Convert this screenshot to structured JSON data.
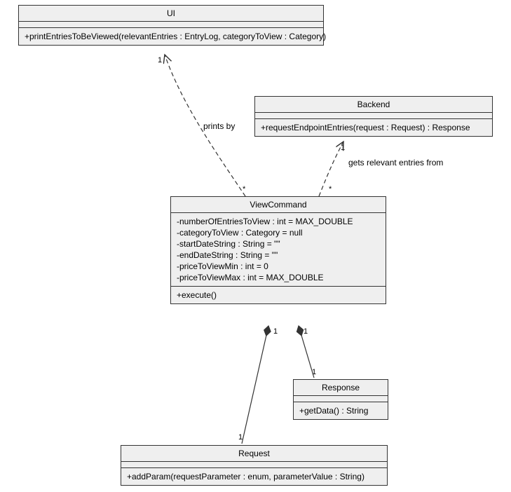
{
  "classes": {
    "ui": {
      "name": "UI",
      "methods": [
        "+printEntriesToBeViewed(relevantEntries : EntryLog, categoryToView : Category)"
      ]
    },
    "backend": {
      "name": "Backend",
      "methods": [
        "+requestEndpointEntries(request : Request) : Response"
      ]
    },
    "viewcommand": {
      "name": "ViewCommand",
      "attrs": [
        "-numberOfEntriesToView : int = MAX_DOUBLE",
        "-categoryToView : Category = null",
        "-startDateString : String = \"\"",
        "-endDateString : String = \"\"",
        "-priceToViewMin : int = 0",
        "-priceToViewMax : int = MAX_DOUBLE"
      ],
      "methods": [
        "+execute()"
      ]
    },
    "response": {
      "name": "Response",
      "methods": [
        "+getData() : String"
      ]
    },
    "request": {
      "name": "Request",
      "methods": [
        "+addParam(requestParameter : enum, parameterValue : String)"
      ]
    }
  },
  "labels": {
    "prints_by": "prints by",
    "gets_entries": "gets relevant entries from"
  },
  "mults": {
    "one": "1",
    "star": "*"
  }
}
